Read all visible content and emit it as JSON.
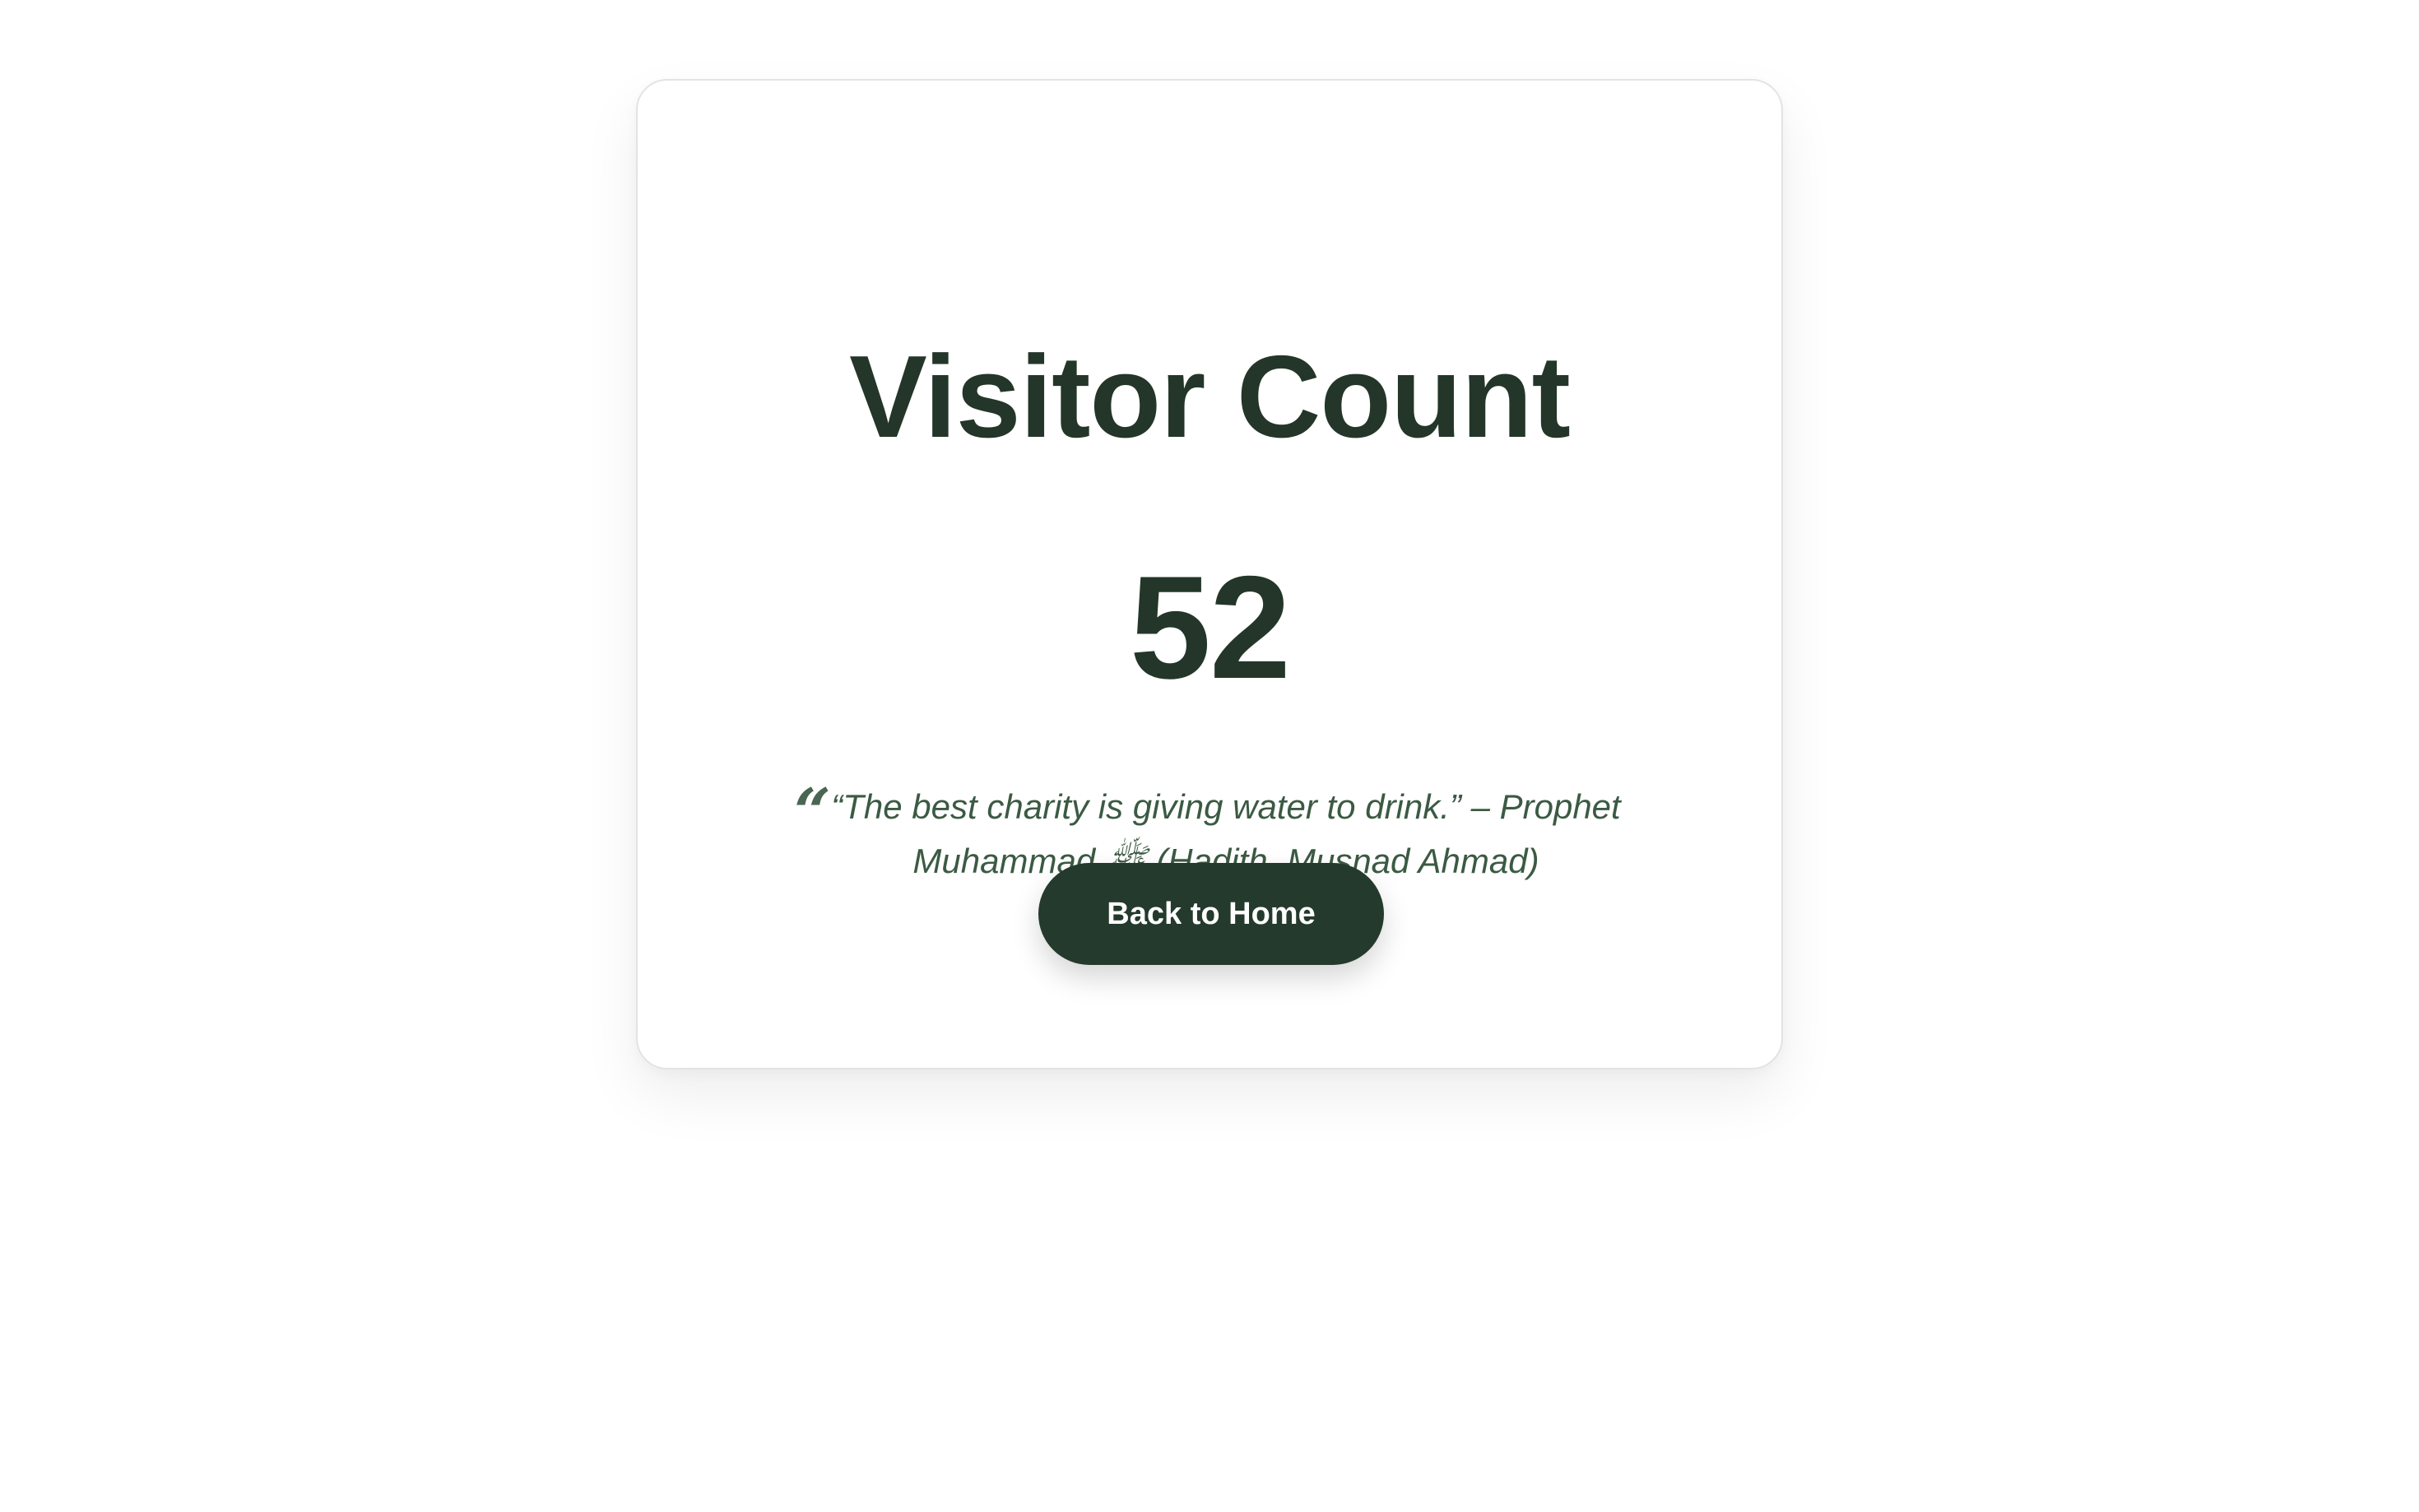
{
  "card": {
    "title": "Visitor Count",
    "count": "52",
    "quote": {
      "mark": "“",
      "text": "“The best charity is giving water to drink.” – Prophet Muhammad ﷺ (Hadith, Musnad Ahmad)"
    },
    "home_button_label": "Back to Home"
  },
  "colors": {
    "primary_dark_green": "#233629",
    "quote_green": "#3b5a43",
    "button_bg": "#243a2c",
    "background": "#ffffff"
  }
}
